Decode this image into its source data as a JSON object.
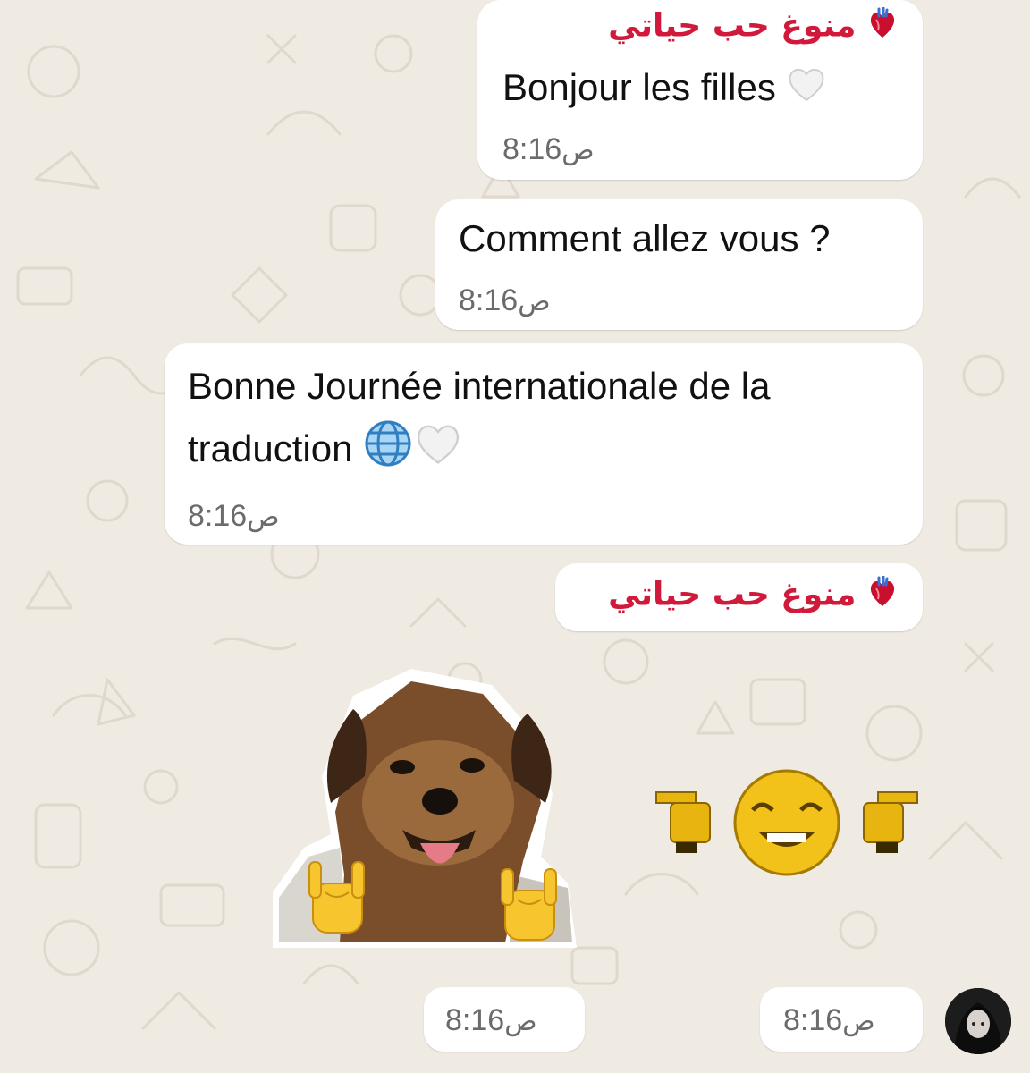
{
  "chat": {
    "messages": [
      {
        "id": "m1",
        "sender": "منوغ حب حياتي",
        "text": "Bonjour les filles",
        "time": "8:16",
        "ampm": "ص"
      },
      {
        "id": "m2",
        "text": "Comment allez vous ?",
        "time": "8:16",
        "ampm": "ص"
      },
      {
        "id": "m3",
        "text_line1": "Bonne Journée internationale de la",
        "text_line2": "traduction",
        "time": "8:16",
        "ampm": "ص"
      },
      {
        "id": "m4",
        "sender": "منوغ حب حياتي"
      },
      {
        "id": "m5",
        "type": "sticker",
        "sticker": "dog-rock-on-sticker",
        "time": "8:16",
        "ampm": "ص"
      },
      {
        "id": "m6",
        "type": "sticker",
        "sticker": "pixel-smiley-pointing-sticker",
        "time": "8:16",
        "ampm": "ص"
      }
    ]
  },
  "icons": {
    "heart": "anatomical-heart-icon",
    "white_heart": "white-heart-icon",
    "globe": "globe-icon",
    "rock_hand": "sign-of-horns-icon",
    "pointing_hand": "pointing-hand-icon"
  },
  "colors": {
    "background": "#efeae2",
    "bubble": "#ffffff",
    "sender": "#d11a3b",
    "text": "#111111",
    "time": "#6b6b6b"
  }
}
